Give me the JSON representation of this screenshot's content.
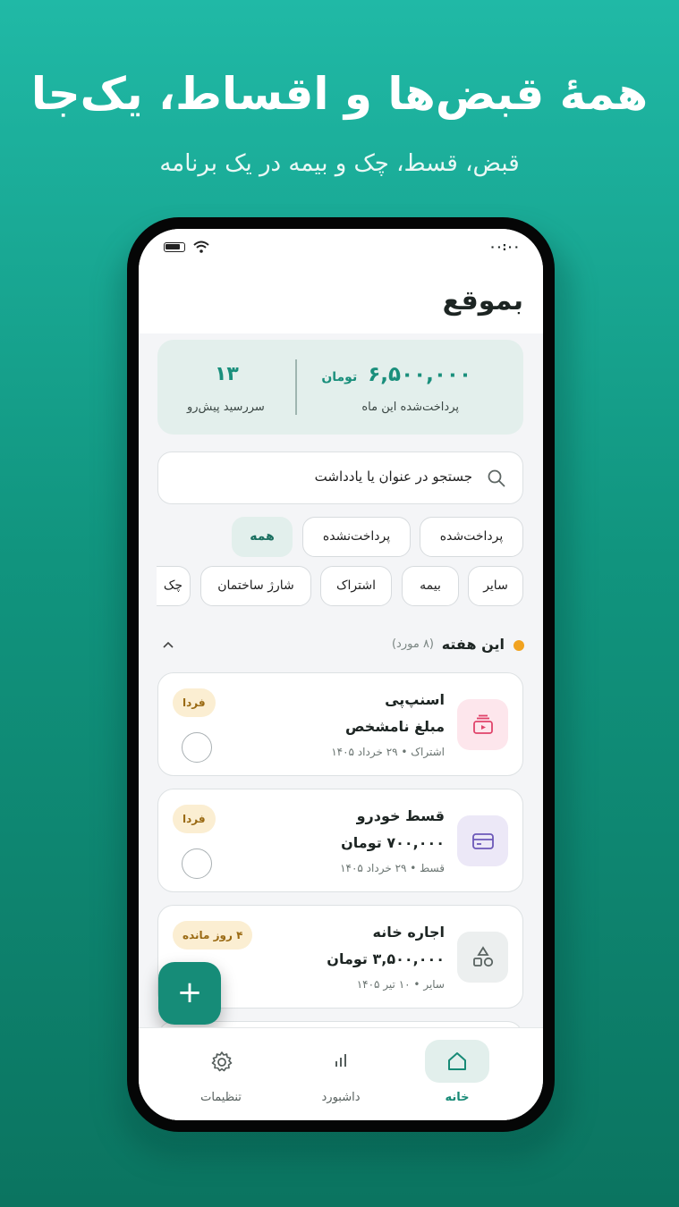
{
  "hero": {
    "title": "همهٔ قبض‌ها و اقساط، یک‌جا",
    "subtitle": "قبض، قسط، چک و بیمه در یک برنامه"
  },
  "status_bar": {
    "time": "۰۰:۰۰"
  },
  "app": {
    "title": "بموقع"
  },
  "summary": {
    "paid_amount": "۶,۵۰۰,۰۰۰",
    "paid_unit": "تومان",
    "paid_label": "پرداخت‌شده این ماه",
    "upcoming_count": "۱۳",
    "upcoming_label": "سررسید پیش‌رو"
  },
  "search": {
    "placeholder": "جستجو در عنوان یا یادداشت"
  },
  "status_filters": [
    "پرداخت‌شده",
    "پرداخت‌نشده",
    "همه"
  ],
  "category_filters": [
    "سایر",
    "بیمه",
    "اشتراک",
    "شارژ ساختمان",
    "چک"
  ],
  "section": {
    "title": "این هفته",
    "count": "(۸ مورد)"
  },
  "cards": [
    {
      "title": "اسنپ‌پی",
      "amount": "مبلغ نامشخص",
      "meta": "اشتراک • ۲۹ خرداد ۱۴۰۵",
      "badge": "فردا",
      "icon": "subscription-icon",
      "icon_bg": "#fde6ec",
      "icon_color": "#e0436a"
    },
    {
      "title": "قسط خودرو",
      "amount": "۷۰۰,۰۰۰ تومان",
      "meta": "قسط • ۲۹ خرداد ۱۴۰۵",
      "badge": "فردا",
      "icon": "card-icon",
      "icon_bg": "#ece8f7",
      "icon_color": "#6c58b8"
    },
    {
      "title": "اجاره خانه",
      "amount": "۳,۵۰۰,۰۰۰ تومان",
      "meta": "سایر • ۱۰ تیر ۱۴۰۵",
      "badge": "۴ روز مانده",
      "icon": "shapes-icon",
      "icon_bg": "#ecefef",
      "icon_color": "#5a6462"
    }
  ],
  "fab": {
    "label": "+"
  },
  "nav": [
    {
      "label": "خانه",
      "icon": "home-icon",
      "active": true
    },
    {
      "label": "داشبورد",
      "icon": "chart-icon",
      "active": false
    },
    {
      "label": "تنظیمات",
      "icon": "gear-icon",
      "active": false
    }
  ],
  "colors": {
    "brand": "#168c78",
    "accent_dot": "#f1a320"
  }
}
